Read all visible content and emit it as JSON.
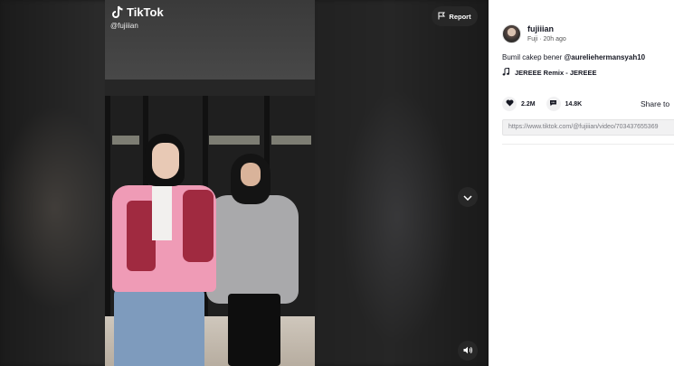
{
  "video": {
    "brand": "TikTok",
    "handle": "@fujiiian",
    "report_label": "Report",
    "icons": {
      "brand": "tiktok-note-icon",
      "report": "flag-icon",
      "next": "chevron-down-icon",
      "volume": "speaker-icon"
    }
  },
  "author": {
    "username": "fujiiian",
    "meta": "Fuji · 20h ago"
  },
  "caption": {
    "text": "Bumil cakep bener ",
    "mention": "@aureliehermansyah10"
  },
  "music": {
    "title": "JEREEE Remix - JEREEE",
    "icon": "music-note-icon"
  },
  "stats": {
    "likes": "2.2M",
    "comments": "14.8K",
    "share_label": "Share to",
    "icons": {
      "likes": "heart-icon",
      "comments": "comment-icon"
    }
  },
  "link": {
    "url": "https://www.tiktok.com/@fujiiian/video/703437655369"
  },
  "colors": {
    "accent": "#fe2c55",
    "text": "#161823",
    "panel_bg": "#ffffff",
    "viewer_bg": "#161616"
  }
}
